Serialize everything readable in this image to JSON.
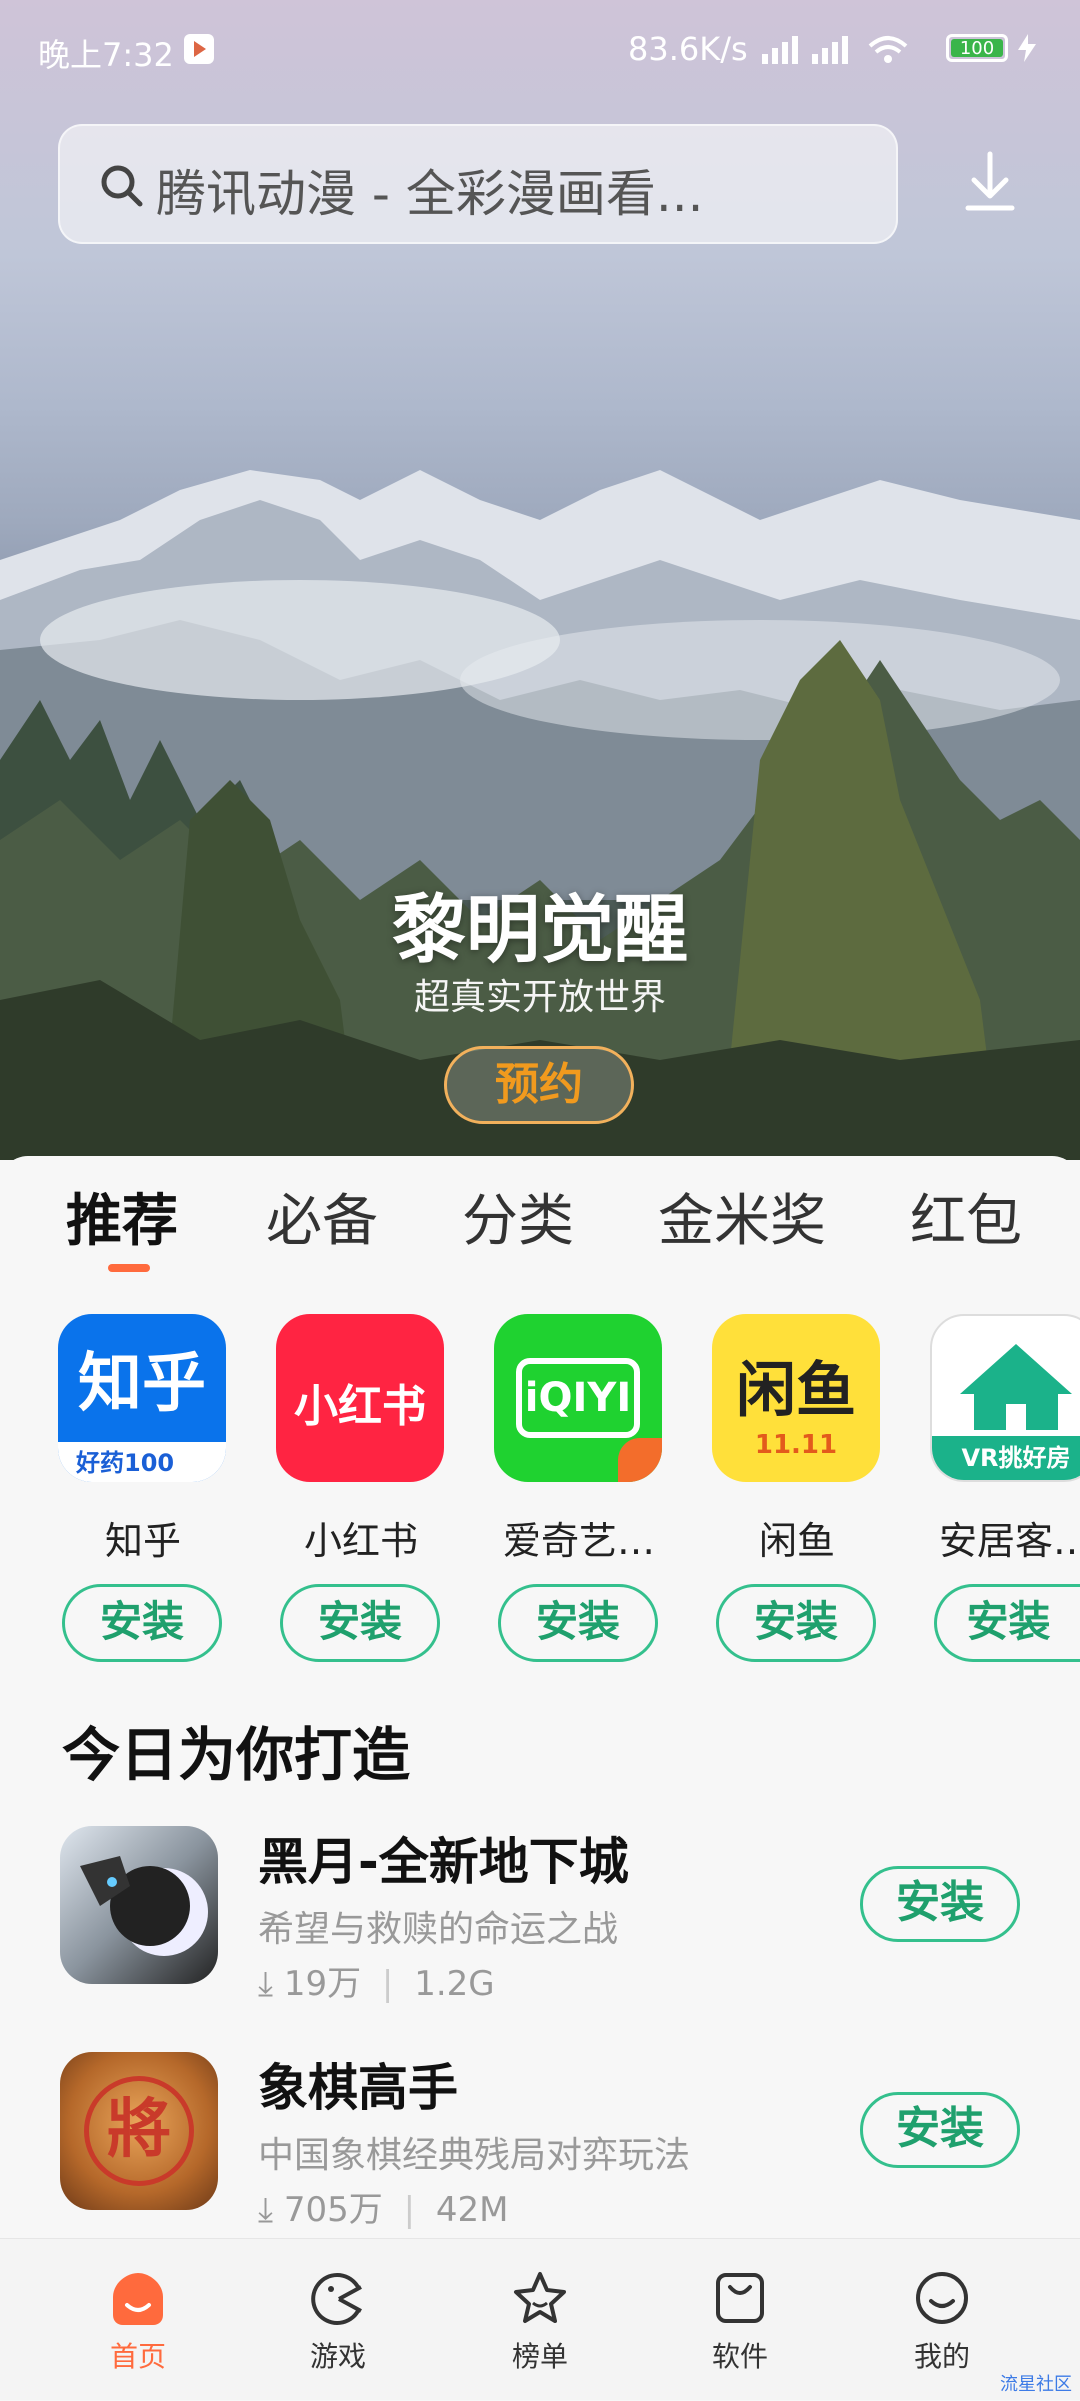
{
  "status_bar": {
    "time": "晚上7:32",
    "network_speed": "83.6K/s",
    "battery": "100"
  },
  "search": {
    "placeholder": "腾讯动漫 - 全彩漫画看..."
  },
  "banner": {
    "title": "黎明觉醒",
    "subtitle": "超真实开放世界",
    "button_label": "预约"
  },
  "tabs": [
    {
      "label": "推荐",
      "active": true
    },
    {
      "label": "必备"
    },
    {
      "label": "分类"
    },
    {
      "label": "金米奖"
    },
    {
      "label": "红包"
    }
  ],
  "featured_apps": [
    {
      "name": "知乎",
      "install_label": "安装",
      "icon_text": "知乎",
      "icon_sub": "好药100",
      "color": "#0a73eb"
    },
    {
      "name": "小红书",
      "install_label": "安装",
      "icon_text": "小红书",
      "color": "#ff2442"
    },
    {
      "name": "爱奇艺…",
      "install_label": "安装",
      "icon_text": "iQIYI",
      "color": "#1fd230"
    },
    {
      "name": "闲鱼",
      "install_label": "安装",
      "icon_text": "闲鱼",
      "icon_sub": "11.11",
      "color": "#ffe03a"
    },
    {
      "name": "安居客…",
      "install_label": "安装",
      "icon_text": "VR挑好房",
      "color": "#1bb28a"
    }
  ],
  "section": {
    "title": "今日为你打造"
  },
  "list": [
    {
      "title": "黑月-全新地下城",
      "desc": "希望与救赎的命运之战",
      "downloads": "19万",
      "size": "1.2G",
      "install_label": "安装"
    },
    {
      "title": "象棋高手",
      "desc": "中国象棋经典残局对弈玩法",
      "downloads": "705万",
      "size": "42M",
      "install_label": "安装",
      "icon_text": "將"
    }
  ],
  "bottom_nav": [
    {
      "label": "首页",
      "icon": "home-icon",
      "active": true
    },
    {
      "label": "游戏",
      "icon": "game-icon"
    },
    {
      "label": "榜单",
      "icon": "star-icon"
    },
    {
      "label": "软件",
      "icon": "bag-icon"
    },
    {
      "label": "我的",
      "icon": "smile-icon"
    }
  ],
  "watermark": "流星社区"
}
